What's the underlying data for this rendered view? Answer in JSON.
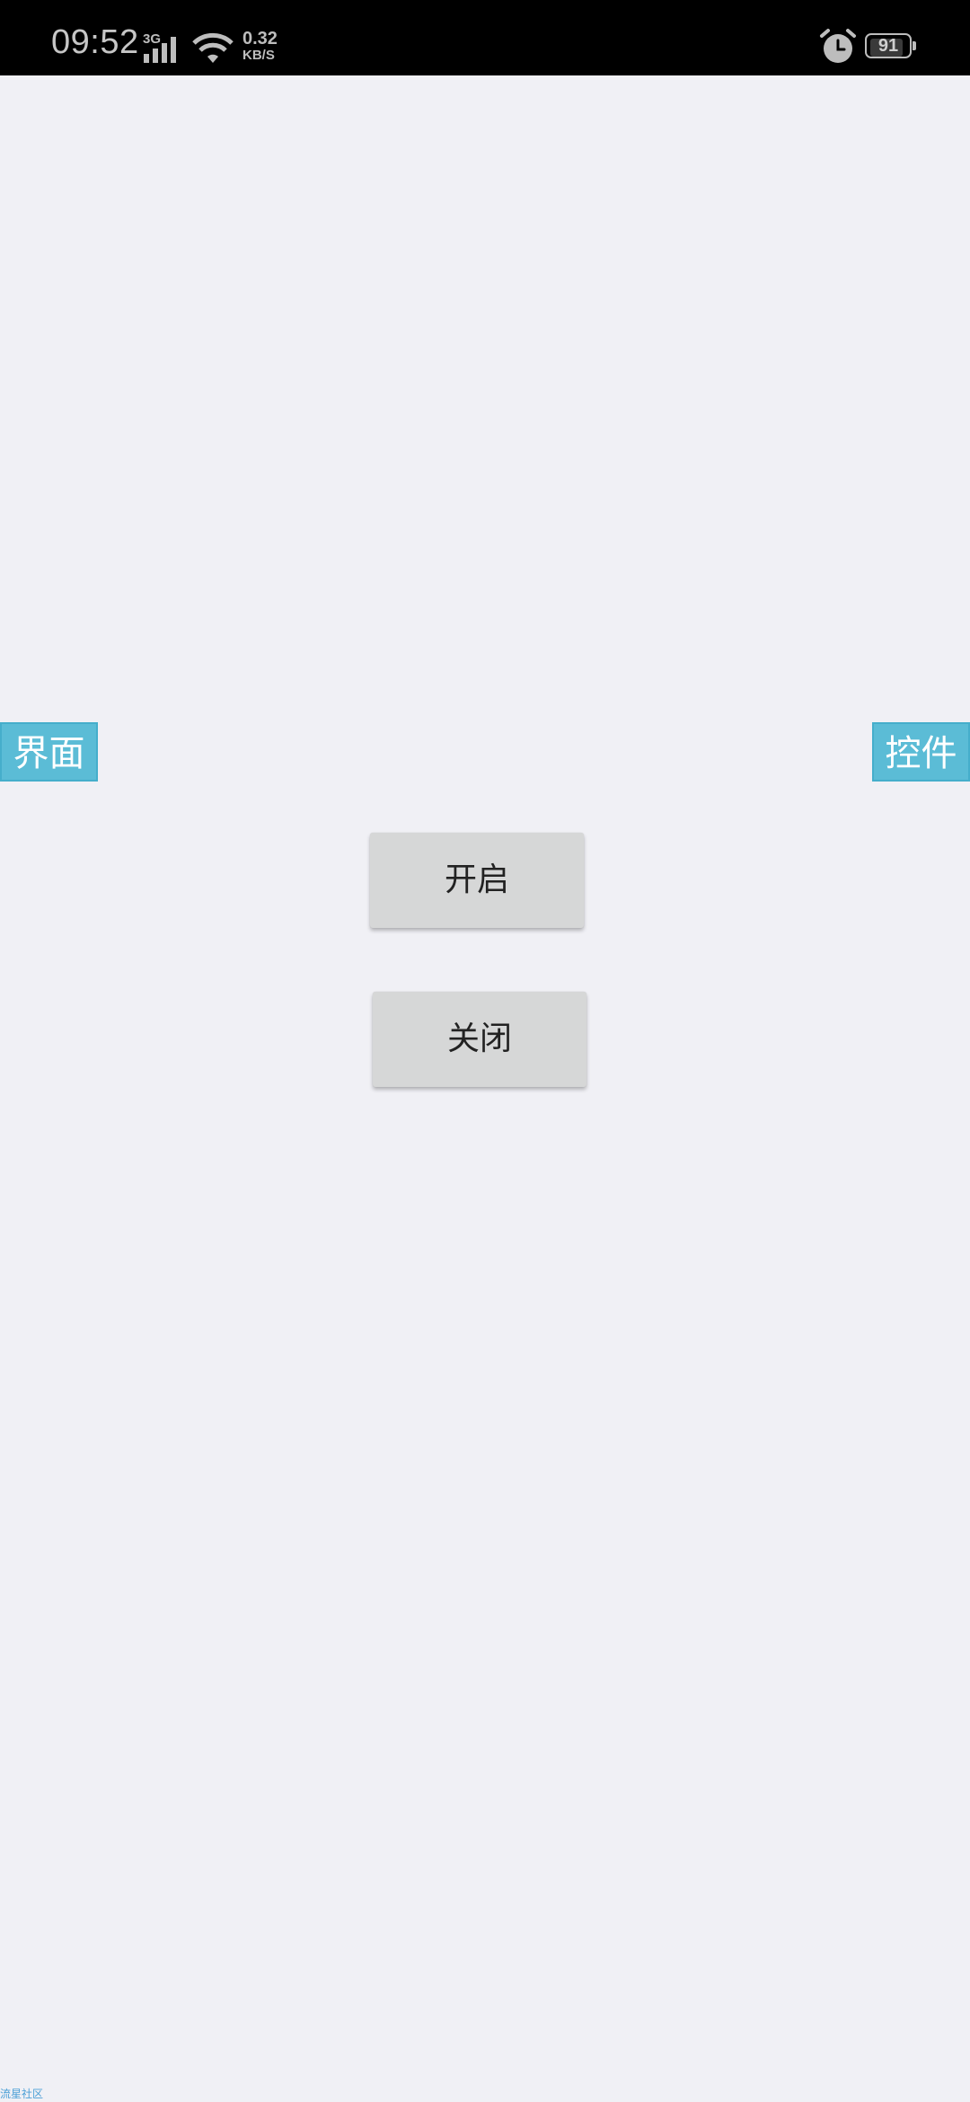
{
  "status_bar": {
    "time": "09:52",
    "network_type": "3G",
    "net_speed_value": "0.32",
    "net_speed_unit": "KB/S",
    "battery_level": "91",
    "battery_fraction": 0.91,
    "icons": [
      "signal-icon",
      "wifi-icon",
      "alarm-icon",
      "battery-icon"
    ]
  },
  "side_tabs": {
    "left_label": "界面",
    "right_label": "控件"
  },
  "buttons": {
    "open_label": "开启",
    "close_label": "关闭"
  },
  "footer": {
    "text": "流星社区"
  },
  "colors": {
    "background": "#f0f0f5",
    "tab_accent": "#5bbcd6",
    "button_bg": "#d6d7d7",
    "status_bar_bg": "#000000"
  }
}
